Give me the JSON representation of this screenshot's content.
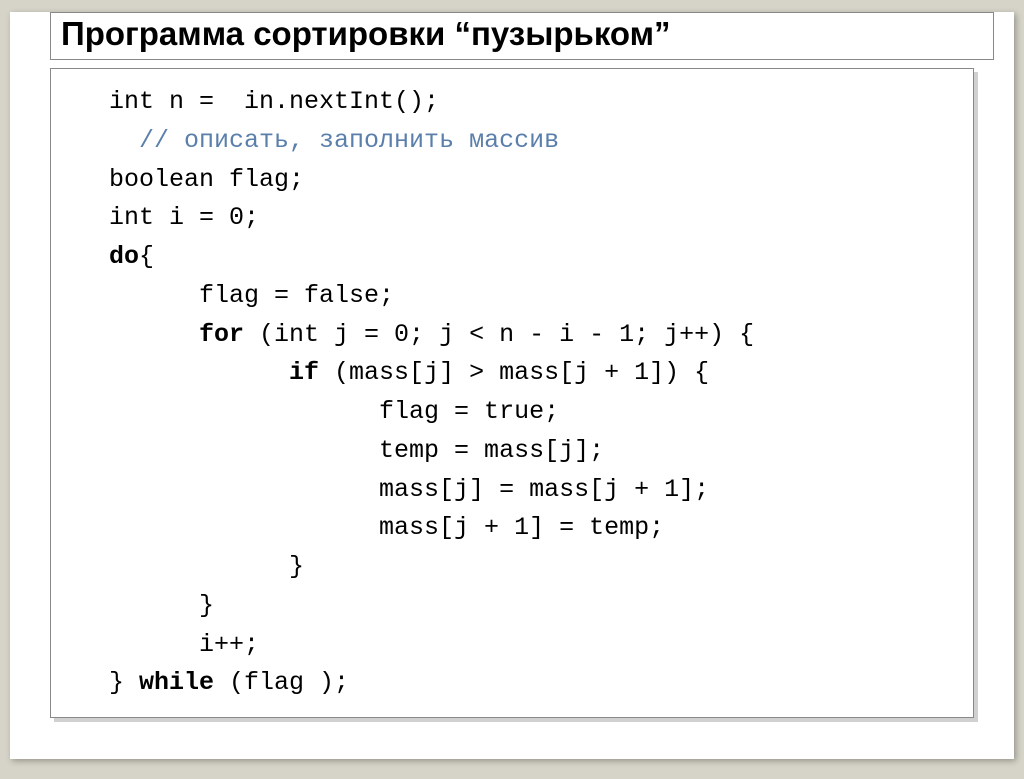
{
  "title": "Программа сортировки “пузырьком”",
  "code": {
    "l1": "int n =  in.nextInt();",
    "l2_indent": "  ",
    "l2_comment": "// описать, заполнить массив",
    "l3": "boolean flag;",
    "l4": "int i = 0;",
    "l5a": "do",
    "l5b": "{",
    "l6": "      flag = false;",
    "l7a": "      ",
    "l7b": "for",
    "l7c": " (int j = 0; j < n - i - 1; j++) {",
    "l8a": "            ",
    "l8b": "if",
    "l8c": " (mass[j] > mass[j + 1]) {",
    "l9": "                  flag = true;",
    "l10": "                  temp = mass[j];",
    "l11": "                  mass[j] = mass[j + 1];",
    "l12": "                  mass[j + 1] = temp;",
    "l13": "            }",
    "l14": "      }",
    "l15": "      i++;",
    "l16a": "} ",
    "l16b": "while",
    "l16c": " (flag );"
  }
}
